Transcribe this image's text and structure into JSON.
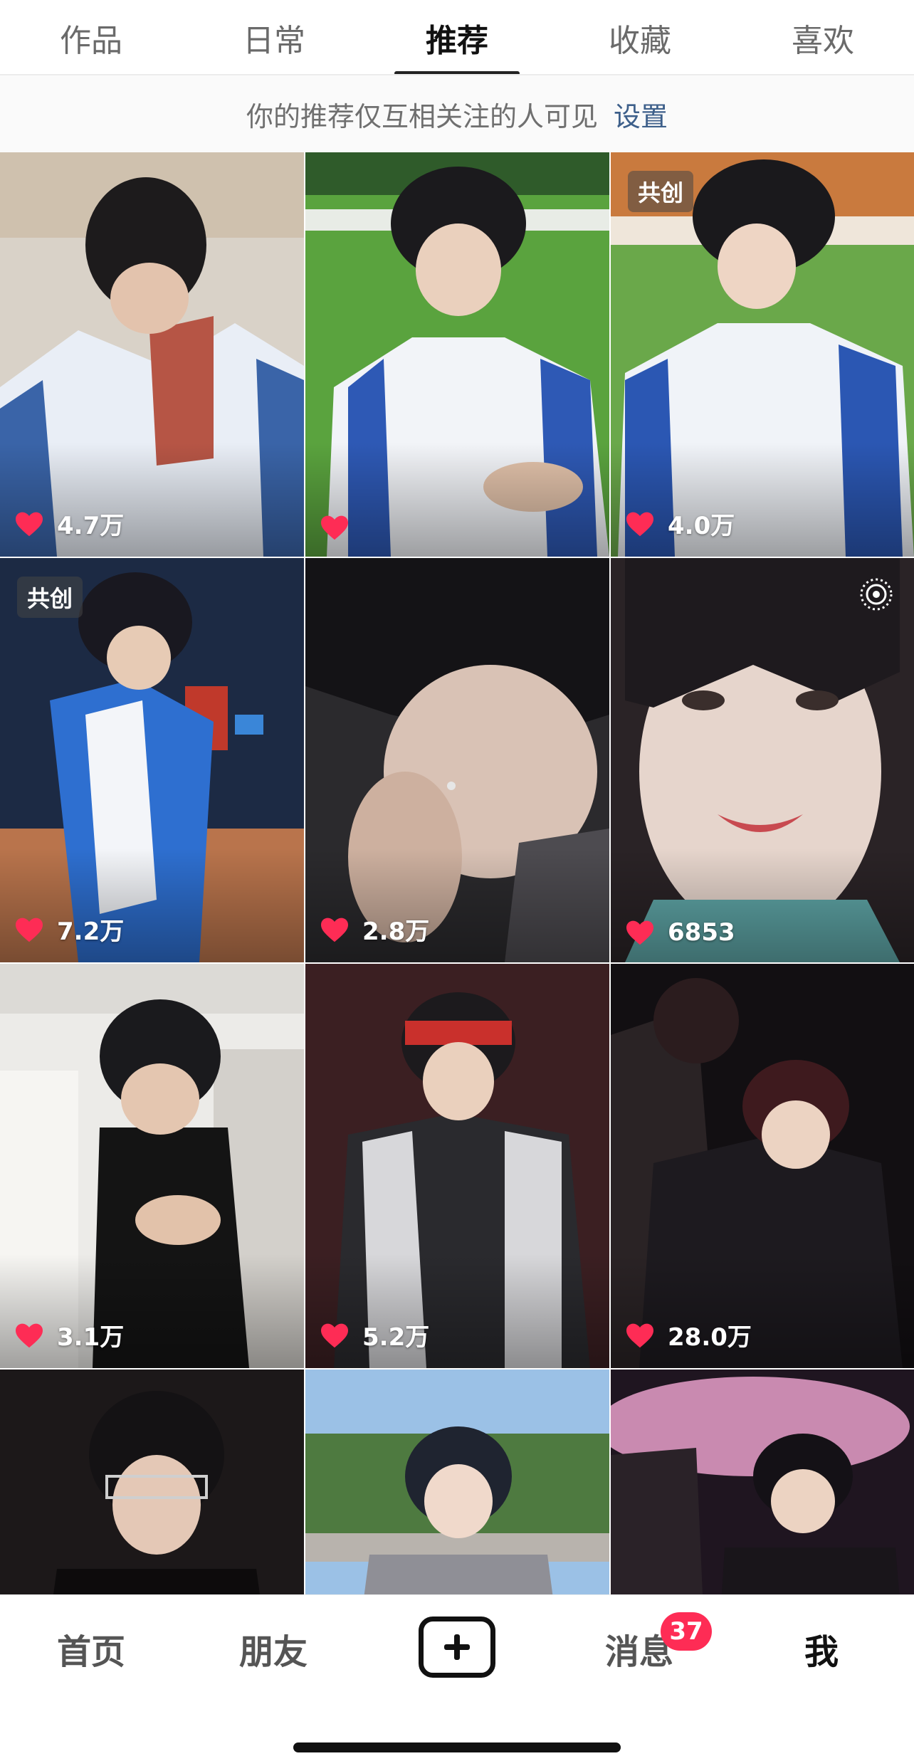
{
  "tabs": [
    {
      "label": "作品",
      "active": false
    },
    {
      "label": "日常",
      "active": false
    },
    {
      "label": "推荐",
      "active": true
    },
    {
      "label": "收藏",
      "active": false
    },
    {
      "label": "喜欢",
      "active": false
    }
  ],
  "notice": {
    "text": "你的推荐仅互相关注的人可见",
    "link": "设置"
  },
  "videos": [
    {
      "likes": "4.7万",
      "badge": null,
      "icon": "heart-icon"
    },
    {
      "likes": "",
      "badge": null,
      "icon": "heart-icon"
    },
    {
      "likes": "4.0万",
      "badge": "共创",
      "icon": "heart-icon"
    },
    {
      "likes": "7.2万",
      "badge": "共创",
      "icon": "heart-icon"
    },
    {
      "likes": "2.8万",
      "badge": null,
      "icon": "heart-icon"
    },
    {
      "likes": "6853",
      "badge": null,
      "icon": "heart-icon",
      "corner_icon": "live-photo-icon"
    },
    {
      "likes": "3.1万",
      "badge": null,
      "icon": "heart-icon"
    },
    {
      "likes": "5.2万",
      "badge": null,
      "icon": "heart-icon"
    },
    {
      "likes": "28.0万",
      "badge": null,
      "icon": "heart-icon"
    },
    {
      "likes": "",
      "badge": null
    },
    {
      "likes": "",
      "badge": null
    },
    {
      "likes": "",
      "badge": null
    }
  ],
  "nav": {
    "home": "首页",
    "friends": "朋友",
    "create_icon": "plus-icon",
    "messages": "消息",
    "messages_badge": "37",
    "me": "我"
  },
  "colors": {
    "like_heart": "#fe2c55",
    "badge_red": "#fe2c55",
    "link": "#3d5f8a"
  }
}
